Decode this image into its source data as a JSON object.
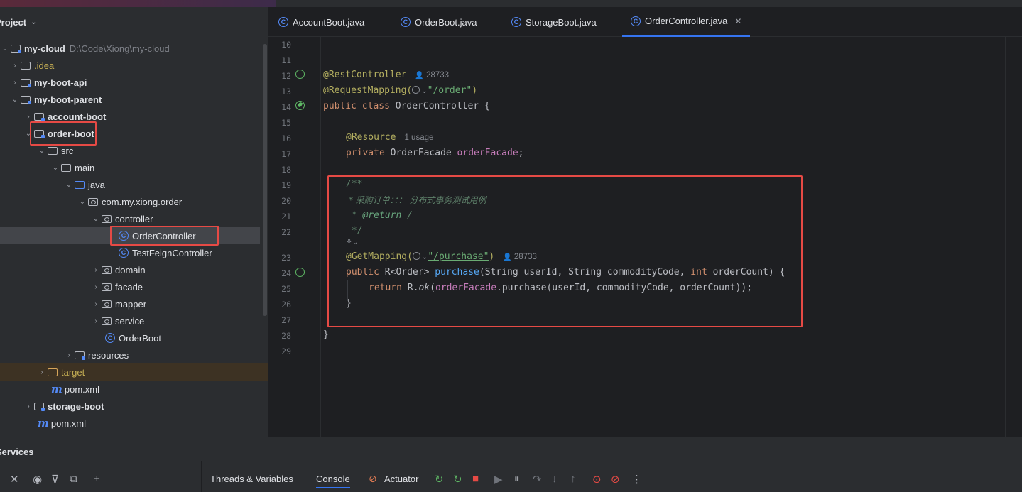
{
  "project_panel": {
    "title": "Project",
    "tree": [
      {
        "label": "my-cloud",
        "path": "D:\\Code\\Xiong\\my-cloud"
      },
      {
        "label": ".idea"
      },
      {
        "label": "my-boot-api"
      },
      {
        "label": "my-boot-parent"
      },
      {
        "label": "account-boot"
      },
      {
        "label": "order-boot"
      },
      {
        "label": "src"
      },
      {
        "label": "main"
      },
      {
        "label": "java"
      },
      {
        "label": "com.my.xiong.order"
      },
      {
        "label": "controller"
      },
      {
        "label": "OrderController"
      },
      {
        "label": "TestFeignController"
      },
      {
        "label": "domain"
      },
      {
        "label": "facade"
      },
      {
        "label": "mapper"
      },
      {
        "label": "service"
      },
      {
        "label": "OrderBoot"
      },
      {
        "label": "resources"
      },
      {
        "label": "target"
      },
      {
        "label": "pom.xml"
      },
      {
        "label": "storage-boot"
      },
      {
        "label": "pom.xml"
      }
    ]
  },
  "editor": {
    "tabs": [
      {
        "label": "AccountBoot.java"
      },
      {
        "label": "OrderBoot.java"
      },
      {
        "label": "StorageBoot.java"
      },
      {
        "label": "OrderController.java",
        "active": true
      }
    ],
    "line_numbers": [
      "10",
      "11",
      "12",
      "13",
      "14",
      "15",
      "16",
      "17",
      "18",
      "19",
      "20",
      "21",
      "22",
      "23",
      "24",
      "25",
      "26",
      "27",
      "28",
      "29"
    ],
    "code": {
      "l12_ann": "@RestController",
      "l12_hint": "28733",
      "l13_ann": "@RequestMapping(",
      "l13_str": "\"/order\"",
      "l13_close": ")",
      "l14_kw": "public class",
      "l14_rest": " OrderController {",
      "l16_ann": "@Resource",
      "l16_hint": "1 usage",
      "l17_kw": "private",
      "l17_type": " OrderFacade ",
      "l17_field": "orderFacade",
      "l17_end": ";",
      "l19": "/**",
      "l20": " * 采购订单：：： 分布式事务测试用例",
      "l21_star": " * ",
      "l21_tag": "@return",
      "l21_rest": " /",
      "l22": " */",
      "l23_ann": "@GetMapping(",
      "l23_str": "\"/purchase\"",
      "l23_close": ")",
      "l23_hint": "28733",
      "l24_kw": "public",
      "l24_type": " R<Order> ",
      "l24_fn": "purchase",
      "l24_params_a": "(String userId, String commodityCode, ",
      "l24_kw2": "int",
      "l24_params_b": " orderCount) {",
      "l25_kw": "return",
      "l25_a": " R.",
      "l25_ok": "ok",
      "l25_b": "(",
      "l25_field": "orderFacade",
      "l25_c": ".purchase(userId, commodityCode, orderCount));",
      "l26": "}",
      "l28": "}"
    }
  },
  "services": {
    "title": "Services",
    "tabs": [
      "Threads & Variables",
      "Console",
      "Actuator"
    ]
  },
  "colors": {
    "accent": "#3574f0",
    "highlight": "#e64a45",
    "annotation": "#b3ae60",
    "keyword": "#cf8e6d",
    "string": "#6aab73"
  }
}
